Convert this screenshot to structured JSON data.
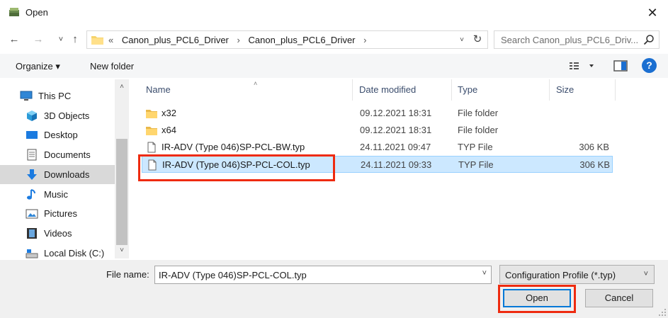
{
  "window": {
    "title": "Open",
    "close_glyph": "✕"
  },
  "nav": {
    "back_glyph": "←",
    "forward_glyph": "→",
    "recent_glyph": "˅",
    "up_glyph": "↑",
    "address": {
      "overflow": "«",
      "crumbs": [
        "Canon_plus_PCL6_Driver",
        "Canon_plus_PCL6_Driver"
      ],
      "separator": "›",
      "dropdown_glyph": "˅",
      "refresh_glyph": "↻"
    },
    "search_placeholder": "Search Canon_plus_PCL6_Driv..."
  },
  "toolbar": {
    "organize_label": "Organize ▾",
    "new_folder_label": "New folder",
    "help_label": "?"
  },
  "sidebar": {
    "items": [
      {
        "label": "This PC",
        "icon": "pc-icon"
      },
      {
        "label": "3D Objects",
        "icon": "cube-icon"
      },
      {
        "label": "Desktop",
        "icon": "desktop-icon"
      },
      {
        "label": "Documents",
        "icon": "documents-icon"
      },
      {
        "label": "Downloads",
        "icon": "download-icon",
        "selected": true
      },
      {
        "label": "Music",
        "icon": "music-icon"
      },
      {
        "label": "Pictures",
        "icon": "pictures-icon"
      },
      {
        "label": "Videos",
        "icon": "videos-icon"
      },
      {
        "label": "Local Disk (C:)",
        "icon": "disk-icon"
      }
    ],
    "scroll_up_glyph": "˄",
    "scroll_down_glyph": "˅"
  },
  "files": {
    "sort_glyph": "˄",
    "columns": [
      "Name",
      "Date modified",
      "Type",
      "Size"
    ],
    "rows": [
      {
        "name": "x32",
        "date": "09.12.2021 18:31",
        "type": "File folder",
        "size": "",
        "kind": "folder"
      },
      {
        "name": "x64",
        "date": "09.12.2021 18:31",
        "type": "File folder",
        "size": "",
        "kind": "folder"
      },
      {
        "name": "IR-ADV (Type 046)SP-PCL-BW.typ",
        "date": "24.11.2021 09:47",
        "type": "TYP File",
        "size": "306 KB",
        "kind": "file"
      },
      {
        "name": "IR-ADV (Type 046)SP-PCL-COL.typ",
        "date": "24.11.2021 09:33",
        "type": "TYP File",
        "size": "306 KB",
        "kind": "file",
        "selected": true
      }
    ]
  },
  "footer": {
    "file_name_label": "File name:",
    "file_name_value": "IR-ADV (Type 046)SP-PCL-COL.typ",
    "file_type_value": "Configuration Profile (*.typ)",
    "dropdown_glyph": "˅",
    "open_label": "Open",
    "cancel_label": "Cancel"
  },
  "colors": {
    "highlight": "#ee2b10",
    "selection_bg": "#cce8ff",
    "accent": "#0078d7"
  }
}
